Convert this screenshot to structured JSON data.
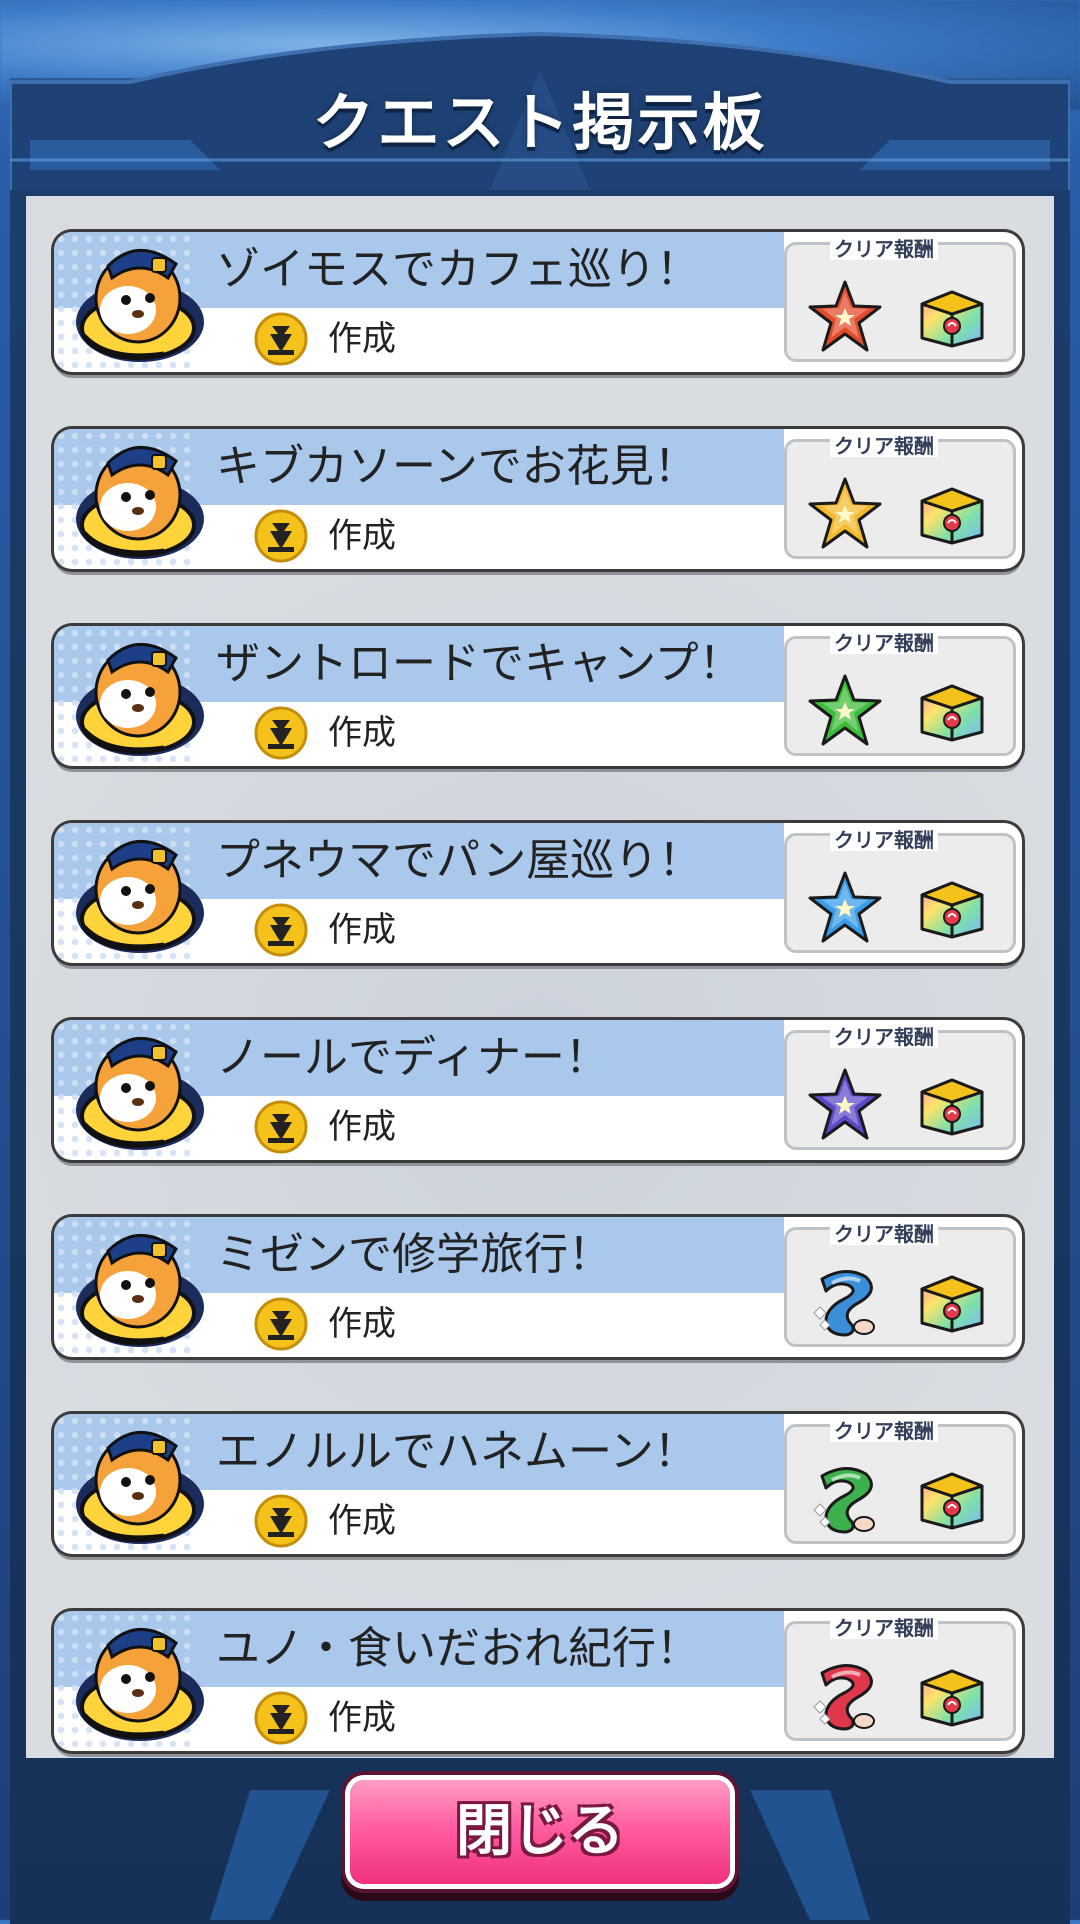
{
  "title": "クエスト掲示板",
  "reward_label": "クリア報酬",
  "create_label": "作成",
  "close_label": "閉じる",
  "quests": [
    {
      "title": "ゾイモスでカフェ巡り！",
      "reward_icon": "star-red-icon"
    },
    {
      "title": "キブカソーンでお花見！",
      "reward_icon": "star-yellow-icon"
    },
    {
      "title": "ザントロードでキャンプ！",
      "reward_icon": "star-green-icon"
    },
    {
      "title": "プネウマでパン屋巡り！",
      "reward_icon": "star-blue-icon"
    },
    {
      "title": "ノールでディナー！",
      "reward_icon": "star-purple-icon"
    },
    {
      "title": "ミゼンで修学旅行！",
      "reward_icon": "scroll-blue-icon"
    },
    {
      "title": "エノルルでハネムーン！",
      "reward_icon": "scroll-green-icon"
    },
    {
      "title": "ユノ・食いだおれ紀行！",
      "reward_icon": "scroll-red-icon"
    }
  ],
  "colors": {
    "band": "#a9c8ec",
    "star_red": "#e24a2c",
    "star_yellow": "#f2b92a",
    "star_green": "#3dbb3a",
    "star_blue": "#3a9be6",
    "star_purple": "#5a4ac8",
    "scroll_blue": "#3b8fd9",
    "scroll_green": "#3cb04a",
    "scroll_red": "#e0384a",
    "button_pink": "#ff5ea0"
  }
}
